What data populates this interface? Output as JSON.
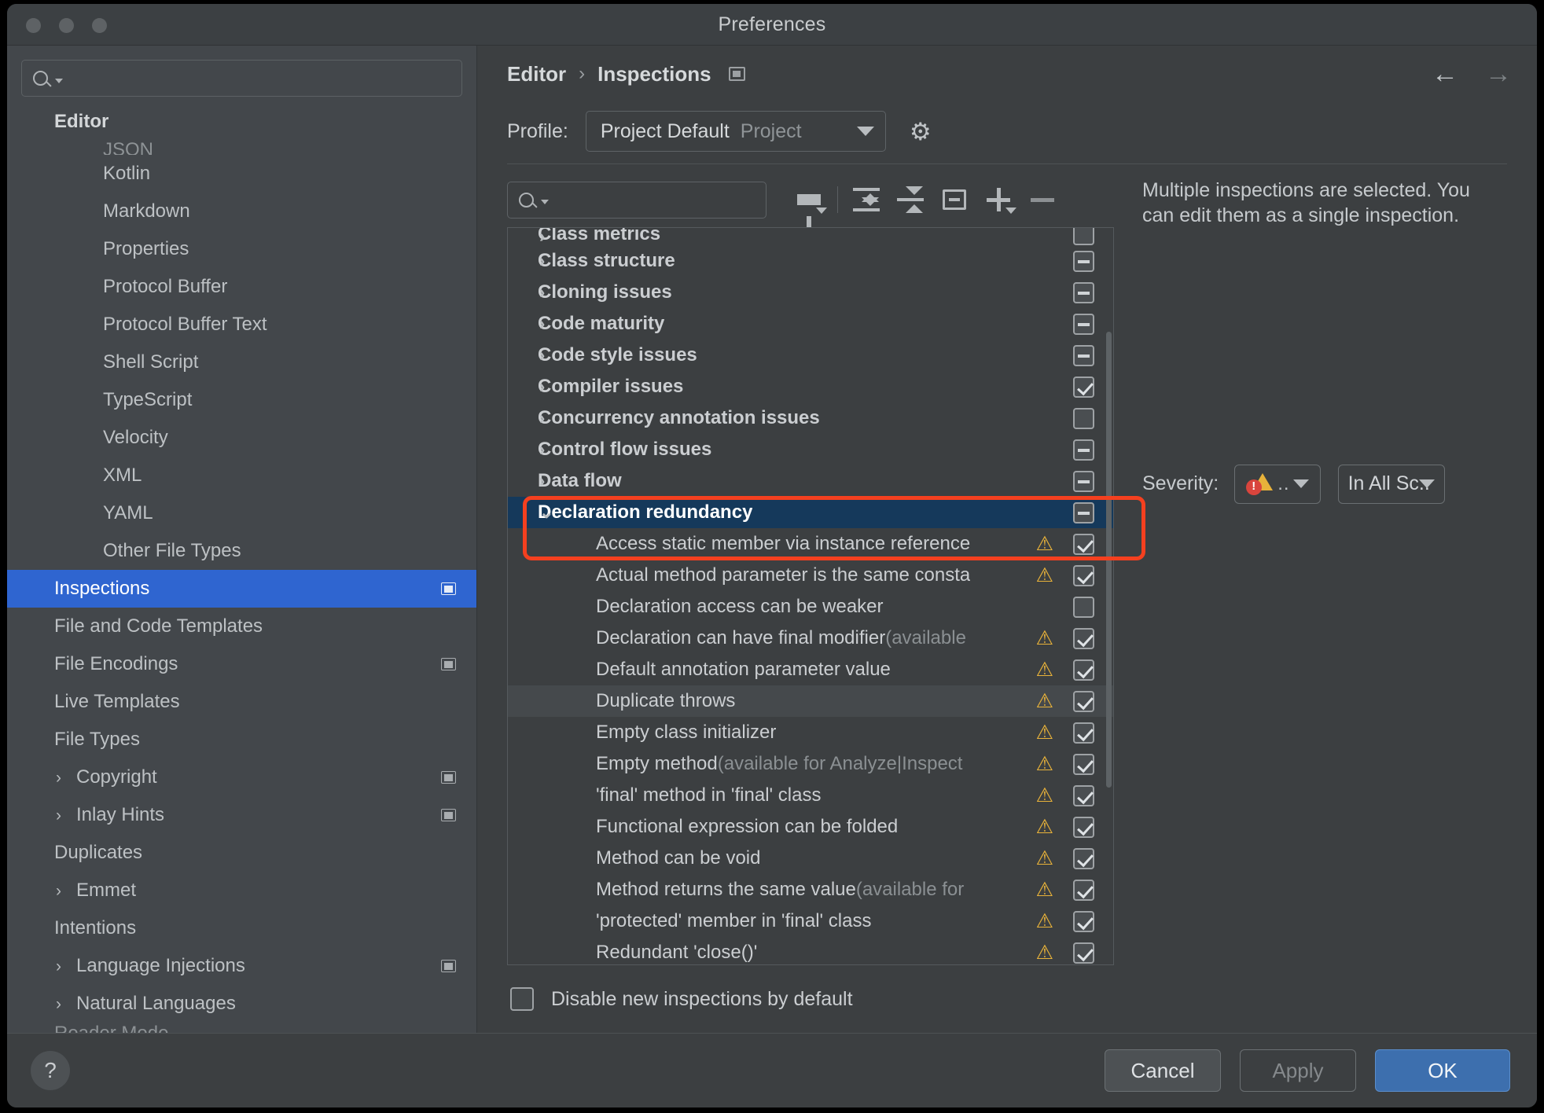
{
  "window": {
    "title": "Preferences"
  },
  "sidebar": {
    "search_placeholder": "",
    "group_label": "Editor",
    "clipped_top_item": "JSON",
    "clipped_bottom_item": "Reader Mode",
    "items": [
      {
        "label": "Kotlin",
        "indent": 1,
        "arrow": false,
        "badge": false,
        "selected": false
      },
      {
        "label": "Markdown",
        "indent": 1,
        "arrow": false,
        "badge": false,
        "selected": false
      },
      {
        "label": "Properties",
        "indent": 1,
        "arrow": false,
        "badge": false,
        "selected": false
      },
      {
        "label": "Protocol Buffer",
        "indent": 1,
        "arrow": false,
        "badge": false,
        "selected": false
      },
      {
        "label": "Protocol Buffer Text",
        "indent": 1,
        "arrow": false,
        "badge": false,
        "selected": false
      },
      {
        "label": "Shell Script",
        "indent": 1,
        "arrow": false,
        "badge": false,
        "selected": false
      },
      {
        "label": "TypeScript",
        "indent": 1,
        "arrow": false,
        "badge": false,
        "selected": false
      },
      {
        "label": "Velocity",
        "indent": 1,
        "arrow": false,
        "badge": false,
        "selected": false
      },
      {
        "label": "XML",
        "indent": 1,
        "arrow": false,
        "badge": false,
        "selected": false
      },
      {
        "label": "YAML",
        "indent": 1,
        "arrow": false,
        "badge": false,
        "selected": false
      },
      {
        "label": "Other File Types",
        "indent": 1,
        "arrow": false,
        "badge": false,
        "selected": false
      },
      {
        "label": "Inspections",
        "indent": 0,
        "arrow": false,
        "badge": true,
        "selected": true
      },
      {
        "label": "File and Code Templates",
        "indent": 0,
        "arrow": false,
        "badge": false,
        "selected": false
      },
      {
        "label": "File Encodings",
        "indent": 0,
        "arrow": false,
        "badge": true,
        "selected": false
      },
      {
        "label": "Live Templates",
        "indent": 0,
        "arrow": false,
        "badge": false,
        "selected": false
      },
      {
        "label": "File Types",
        "indent": 0,
        "arrow": false,
        "badge": false,
        "selected": false
      },
      {
        "label": "Copyright",
        "indent": 0,
        "arrow": true,
        "badge": true,
        "selected": false
      },
      {
        "label": "Inlay Hints",
        "indent": 0,
        "arrow": true,
        "badge": true,
        "selected": false
      },
      {
        "label": "Duplicates",
        "indent": 0,
        "arrow": false,
        "badge": false,
        "selected": false
      },
      {
        "label": "Emmet",
        "indent": 0,
        "arrow": true,
        "badge": false,
        "selected": false
      },
      {
        "label": "Intentions",
        "indent": 0,
        "arrow": false,
        "badge": false,
        "selected": false
      },
      {
        "label": "Language Injections",
        "indent": 0,
        "arrow": true,
        "badge": true,
        "selected": false
      },
      {
        "label": "Natural Languages",
        "indent": 0,
        "arrow": true,
        "badge": false,
        "selected": false
      }
    ]
  },
  "breadcrumb": {
    "parent": "Editor",
    "separator": "›",
    "current": "Inspections"
  },
  "nav": {
    "back_icon": "←",
    "forward_icon": "→"
  },
  "profile": {
    "label": "Profile:",
    "value": "Project Default",
    "scope": "Project",
    "gear_icon": "⚙"
  },
  "toolbar": {
    "search_placeholder": "",
    "buttons": [
      {
        "name": "filter",
        "title": "Filter inspections"
      },
      {
        "name": "expand-all",
        "title": "Expand all"
      },
      {
        "name": "collapse-all",
        "title": "Collapse all"
      },
      {
        "name": "reset-to-defaults",
        "title": "Reset to defaults"
      },
      {
        "name": "add",
        "title": "Add"
      },
      {
        "name": "remove",
        "title": "Remove"
      }
    ]
  },
  "tree": {
    "rows": [
      {
        "label": "Class metrics",
        "type": "group",
        "check": "none",
        "warn": false,
        "state": "clipped"
      },
      {
        "label": "Class structure",
        "type": "group",
        "check": "indeterminate",
        "warn": false,
        "state": "normal"
      },
      {
        "label": "Cloning issues",
        "type": "group",
        "check": "indeterminate",
        "warn": false,
        "state": "normal"
      },
      {
        "label": "Code maturity",
        "type": "group",
        "check": "indeterminate",
        "warn": false,
        "state": "normal"
      },
      {
        "label": "Code style issues",
        "type": "group",
        "check": "indeterminate",
        "warn": false,
        "state": "normal"
      },
      {
        "label": "Compiler issues",
        "type": "group",
        "check": "checked",
        "warn": false,
        "state": "normal"
      },
      {
        "label": "Concurrency annotation issues",
        "type": "group",
        "check": "unchecked",
        "warn": false,
        "state": "normal"
      },
      {
        "label": "Control flow issues",
        "type": "group",
        "check": "indeterminate",
        "warn": false,
        "state": "normal"
      },
      {
        "label": "Data flow",
        "type": "group",
        "check": "indeterminate",
        "warn": false,
        "state": "normal"
      },
      {
        "label": "Declaration redundancy",
        "type": "group",
        "check": "indeterminate",
        "warn": false,
        "state": "selected",
        "expanded": true
      },
      {
        "label": "Access static member via instance reference",
        "type": "leaf",
        "check": "checked",
        "warn": true,
        "state": "normal"
      },
      {
        "label": "Actual method parameter is the same consta",
        "type": "leaf",
        "check": "checked",
        "warn": true,
        "state": "normal"
      },
      {
        "label": "Declaration access can be weaker",
        "type": "leaf",
        "check": "unchecked",
        "warn": false,
        "state": "normal"
      },
      {
        "label": "Declaration can have final modifier",
        "suffix": " (available",
        "type": "leaf",
        "check": "checked",
        "warn": true,
        "state": "normal"
      },
      {
        "label": "Default annotation parameter value",
        "type": "leaf",
        "check": "checked",
        "warn": true,
        "state": "normal"
      },
      {
        "label": "Duplicate throws",
        "type": "leaf",
        "check": "checked",
        "warn": true,
        "state": "hover"
      },
      {
        "label": "Empty class initializer",
        "type": "leaf",
        "check": "checked",
        "warn": true,
        "state": "normal"
      },
      {
        "label": "Empty method",
        "suffix": " (available for Analyze|Inspect",
        "type": "leaf",
        "check": "checked",
        "warn": true,
        "state": "normal"
      },
      {
        "label": "'final' method in 'final' class",
        "type": "leaf",
        "check": "checked",
        "warn": true,
        "state": "normal"
      },
      {
        "label": "Functional expression can be folded",
        "type": "leaf",
        "check": "checked",
        "warn": true,
        "state": "normal"
      },
      {
        "label": "Method can be void",
        "type": "leaf",
        "check": "checked",
        "warn": true,
        "state": "normal"
      },
      {
        "label": "Method returns the same value",
        "suffix": " (available for",
        "type": "leaf",
        "check": "checked",
        "warn": true,
        "state": "normal"
      },
      {
        "label": "'protected' member in 'final' class",
        "type": "leaf",
        "check": "checked",
        "warn": true,
        "state": "normal"
      },
      {
        "label": "Redundant 'close()'",
        "type": "leaf",
        "check": "checked",
        "warn": true,
        "state": "normal"
      }
    ],
    "warn_icon": "⚠",
    "expanded_chevron": "⌄",
    "collapsed_chevron": "›"
  },
  "disable_option": {
    "label": "Disable new inspections by default",
    "checked": false
  },
  "details": {
    "description": "Multiple inspections are selected. You can edit them as a single inspection.",
    "severity_label": "Severity:",
    "severity_value": "..",
    "scope_value": "In All Sc.."
  },
  "footer": {
    "help_icon": "?",
    "cancel_label": "Cancel",
    "apply_label": "Apply",
    "ok_label": "OK"
  },
  "colors": {
    "selection_blue": "#2f65d0",
    "tree_selection": "#15395b",
    "accent_ok": "#3d6fae",
    "annotation_red": "#f5401f",
    "warning_yellow": "#e8b23a",
    "error_red": "#d9453d"
  }
}
